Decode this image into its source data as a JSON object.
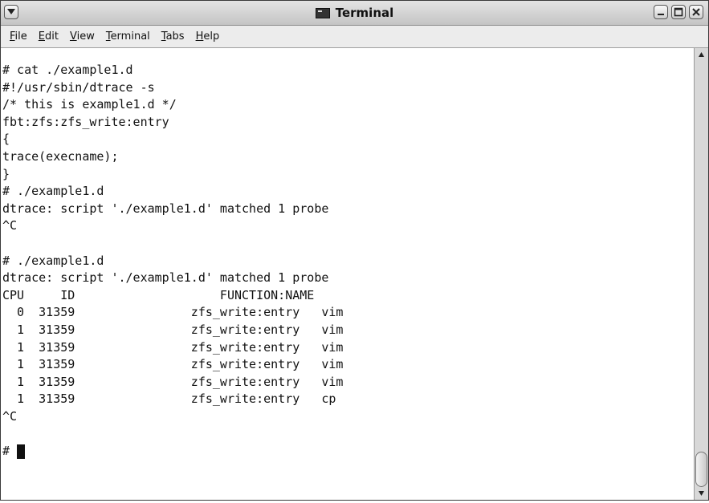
{
  "window": {
    "title": "Terminal",
    "icons": [
      "window-menu-icon",
      "terminal-icon",
      "minimize-icon",
      "maximize-icon",
      "close-icon"
    ]
  },
  "menubar": {
    "items": [
      {
        "label": "File",
        "mnemonic": "F",
        "rest": "ile"
      },
      {
        "label": "Edit",
        "mnemonic": "E",
        "rest": "dit"
      },
      {
        "label": "View",
        "mnemonic": "V",
        "rest": "iew"
      },
      {
        "label": "Terminal",
        "mnemonic": "T",
        "rest": "erminal"
      },
      {
        "label": "Tabs",
        "mnemonic": "T",
        "rest": "abs"
      },
      {
        "label": "Help",
        "mnemonic": "H",
        "rest": "elp"
      }
    ]
  },
  "terminal": {
    "lines": [
      "# cat ./example1.d",
      "#!/usr/sbin/dtrace -s",
      "/* this is example1.d */",
      "fbt:zfs:zfs_write:entry",
      "{",
      "trace(execname);",
      "}",
      "# ./example1.d",
      "dtrace: script './example1.d' matched 1 probe",
      "^C",
      "",
      "# ./example1.d",
      "dtrace: script './example1.d' matched 1 probe",
      "CPU     ID                    FUNCTION:NAME",
      "  0  31359                zfs_write:entry   vim",
      "  1  31359                zfs_write:entry   vim",
      "  1  31359                zfs_write:entry   vim",
      "  1  31359                zfs_write:entry   vim",
      "  1  31359                zfs_write:entry   vim",
      "  1  31359                zfs_write:entry   cp",
      "^C",
      ""
    ],
    "prompt": "#"
  },
  "scrollbar": {
    "position": 1.0
  }
}
